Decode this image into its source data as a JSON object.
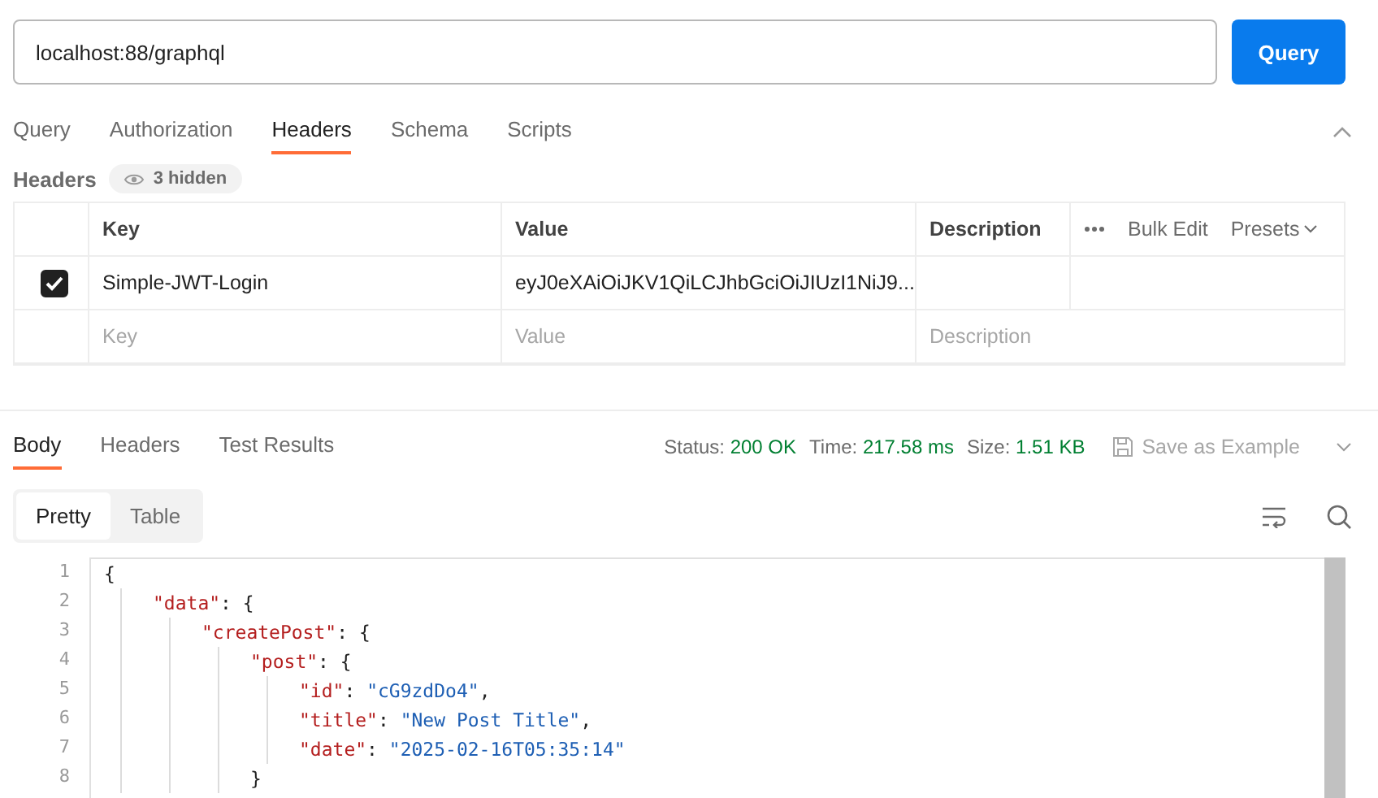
{
  "url_bar": {
    "value": "localhost:88/graphql",
    "button": "Query"
  },
  "request_tabs": [
    {
      "label": "Query",
      "selected": false
    },
    {
      "label": "Authorization",
      "selected": false
    },
    {
      "label": "Headers",
      "selected": true
    },
    {
      "label": "Schema",
      "selected": false
    },
    {
      "label": "Scripts",
      "selected": false
    }
  ],
  "headers_section": {
    "title": "Headers",
    "hidden_badge": "3 hidden"
  },
  "headers_table": {
    "columns": [
      "Key",
      "Value",
      "Description"
    ],
    "actions": {
      "bulk_edit": "Bulk Edit",
      "presets": "Presets"
    },
    "rows": [
      {
        "checked": true,
        "key": "Simple-JWT-Login",
        "value": "eyJ0eXAiOiJKV1QiLCJhbGciOiJIUzI1NiJ9..."
      }
    ],
    "new_row": {
      "key_placeholder": "Key",
      "value_placeholder": "Value",
      "description_placeholder": "Description"
    }
  },
  "response_tabs": [
    {
      "label": "Body",
      "selected": true
    },
    {
      "label": "Headers",
      "selected": false
    },
    {
      "label": "Test Results",
      "selected": false
    }
  ],
  "response_meta": [
    {
      "label": "Status:",
      "value": "200 OK"
    },
    {
      "label": "Time:",
      "value": "217.58 ms"
    },
    {
      "label": "Size:",
      "value": "1.51 KB"
    }
  ],
  "save_example": "Save as Example",
  "view_modes": [
    {
      "label": "Pretty",
      "selected": true
    },
    {
      "label": "Table",
      "selected": false
    }
  ],
  "code": [
    {
      "number": "1",
      "tokens": [
        {
          "kind": "punct",
          "text": "{"
        }
      ],
      "children": [
        {
          "number": "2",
          "tokens": [
            {
              "kind": "key",
              "text": "\"data\""
            },
            {
              "kind": "punct",
              "text": ": {"
            }
          ],
          "children": [
            {
              "number": "3",
              "tokens": [
                {
                  "kind": "key",
                  "text": "\"createPost\""
                },
                {
                  "kind": "punct",
                  "text": ": {"
                }
              ],
              "children": [
                {
                  "number": "4",
                  "tokens": [
                    {
                      "kind": "key",
                      "text": "\"post\""
                    },
                    {
                      "kind": "punct",
                      "text": ": {"
                    }
                  ],
                  "children": [
                    {
                      "number": "5",
                      "tokens": [
                        {
                          "kind": "key",
                          "text": "\"id\""
                        },
                        {
                          "kind": "punct",
                          "text": ": "
                        },
                        {
                          "kind": "string",
                          "text": "\"cG9zdDo4\""
                        },
                        {
                          "kind": "punct",
                          "text": ","
                        }
                      ]
                    },
                    {
                      "number": "6",
                      "tokens": [
                        {
                          "kind": "key",
                          "text": "\"title\""
                        },
                        {
                          "kind": "punct",
                          "text": ": "
                        },
                        {
                          "kind": "string",
                          "text": "\"New Post Title\""
                        },
                        {
                          "kind": "punct",
                          "text": ","
                        }
                      ]
                    },
                    {
                      "number": "7",
                      "tokens": [
                        {
                          "kind": "key",
                          "text": "\"date\""
                        },
                        {
                          "kind": "punct",
                          "text": ": "
                        },
                        {
                          "kind": "string",
                          "text": "\"2025-02-16T05:35:14\""
                        }
                      ]
                    }
                  ]
                },
                {
                  "number": "8",
                  "tokens": [
                    {
                      "kind": "punct",
                      "text": "}"
                    }
                  ]
                }
              ]
            }
          ]
        }
      ]
    }
  ]
}
